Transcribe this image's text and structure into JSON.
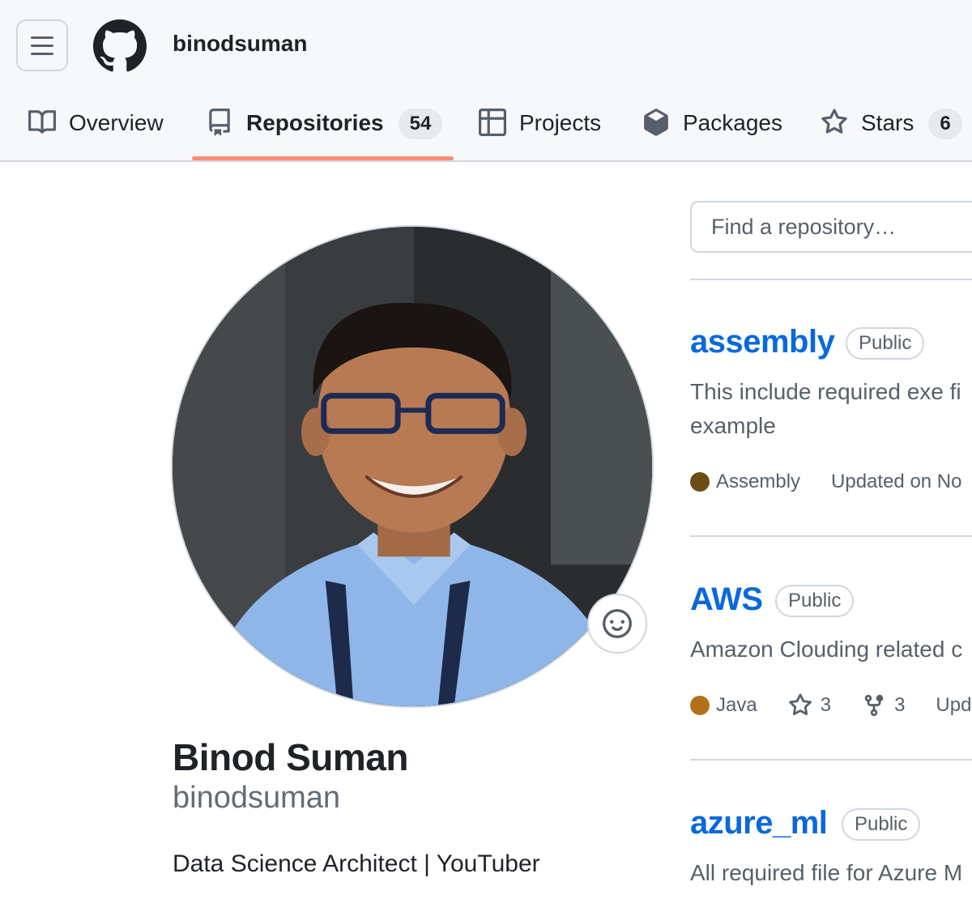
{
  "header": {
    "owner": "binodsuman"
  },
  "tabs": [
    {
      "label": "Overview",
      "icon": "book-icon"
    },
    {
      "label": "Repositories",
      "icon": "repo-icon",
      "count": "54",
      "active": true
    },
    {
      "label": "Projects",
      "icon": "table-icon"
    },
    {
      "label": "Packages",
      "icon": "package-icon"
    },
    {
      "label": "Stars",
      "icon": "star-icon",
      "count": "6"
    }
  ],
  "profile": {
    "full_name": "Binod Suman",
    "username": "binodsuman",
    "bio": "Data Science Architect | YouTuber"
  },
  "search": {
    "placeholder": "Find a repository…"
  },
  "repos": [
    {
      "name": "assembly",
      "visibility": "Public",
      "description_lines": [
        "This include required exe fi",
        "example"
      ],
      "language": "Assembly",
      "language_color": "#6e4c13",
      "updated": "Updated on No"
    },
    {
      "name": "AWS",
      "visibility": "Public",
      "description_lines": [
        "Amazon Clouding related c"
      ],
      "language": "Java",
      "language_color": "#b07219",
      "stars": "3",
      "forks": "3",
      "updated": "Upd"
    },
    {
      "name": "azure_ml",
      "visibility": "Public",
      "description_lines": [
        "All required file for Azure M"
      ]
    }
  ],
  "colors": {
    "accent_link": "#0969da",
    "tab_underline": "#fd8c73"
  }
}
